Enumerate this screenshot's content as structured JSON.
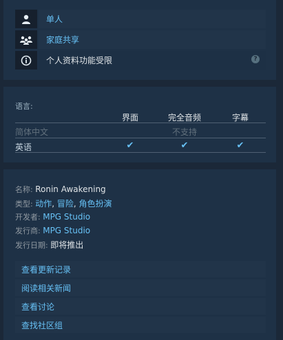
{
  "features": [
    {
      "icon": "single-player-icon",
      "label": "单人"
    },
    {
      "icon": "family-sharing-icon",
      "label": "家庭共享"
    },
    {
      "icon": "info-icon",
      "label": "个人资料功能受限",
      "help": "?"
    }
  ],
  "languages": {
    "title": "语言:",
    "columns": [
      "界面",
      "完全音频",
      "字幕"
    ],
    "rows": [
      {
        "name": "简体中文",
        "note": "不支持"
      },
      {
        "name": "英语",
        "checks": [
          "✔",
          "✔",
          "✔"
        ]
      }
    ]
  },
  "details": {
    "name_label": "名称:",
    "name_value": "Ronin Awakening",
    "type_label": "类型:",
    "genres": [
      "动作",
      "冒险",
      "角色扮演"
    ],
    "developer_label": "开发者:",
    "developer": "MPG Studio",
    "publisher_label": "发行商:",
    "publisher": "MPG Studio",
    "release_label": "发行日期:",
    "release_value": "即将推出"
  },
  "links": [
    "查看更新记录",
    "阅读相关新闻",
    "查看讨论",
    "查找社区组"
  ],
  "colors": {
    "accent": "#67c1f5",
    "background": "#1b2838",
    "panel": "#1e3146"
  }
}
